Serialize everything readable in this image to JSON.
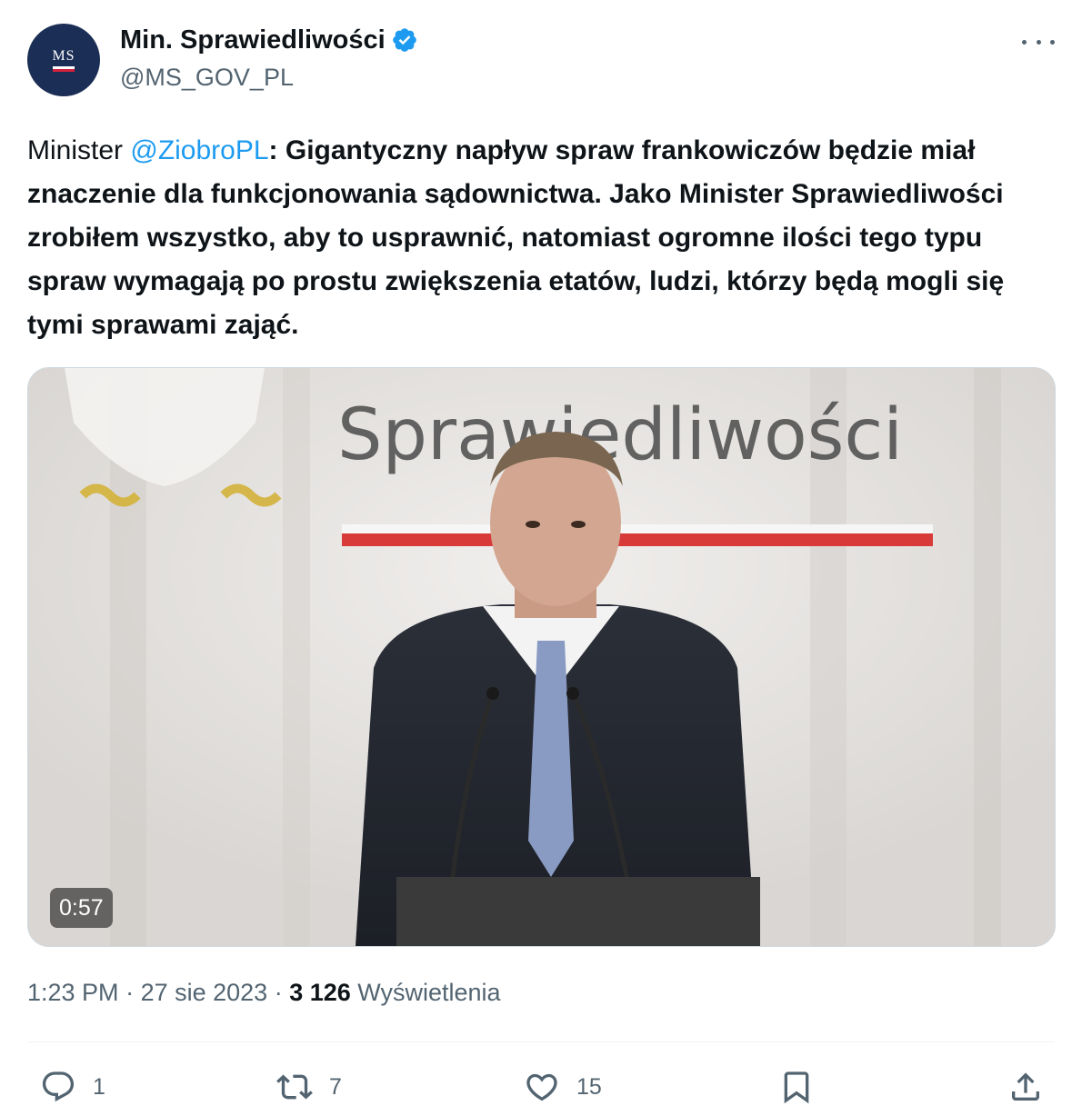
{
  "account": {
    "display_name": "Min. Sprawiedliwości",
    "handle": "@MS_GOV_PL",
    "avatar_text": "MS",
    "verified_icon": "verified-badge-icon"
  },
  "tweet": {
    "prefix": "Minister ",
    "mention": "@ZiobroPL",
    "body": ": Gigantyczny napływ spraw frankowiczów będzie miał znaczenie dla funkcjonowania sądownictwa. Jako Minister Sprawiedliwości zrobiłem wszystko, aby to usprawnić, natomiast ogromne ilości tego typu spraw wymagają po prostu zwiększenia etatów, ludzi, którzy będą mogli się tymi sprawami zająć."
  },
  "media": {
    "type": "video",
    "duration": "0:57",
    "backdrop_text": "Sprawiedliwości"
  },
  "meta": {
    "time": "1:23 PM",
    "separator": " · ",
    "date": "27 sie 2023",
    "views_count": "3 126",
    "views_label": " Wyświetlenia"
  },
  "actions": {
    "reply_count": "1",
    "retweet_count": "7",
    "like_count": "15"
  },
  "colors": {
    "link": "#1d9bf0",
    "secondary_text": "#536471",
    "primary_text": "#0f1419",
    "avatar_bg": "#1b2e55",
    "flag_red": "#d4213d"
  }
}
